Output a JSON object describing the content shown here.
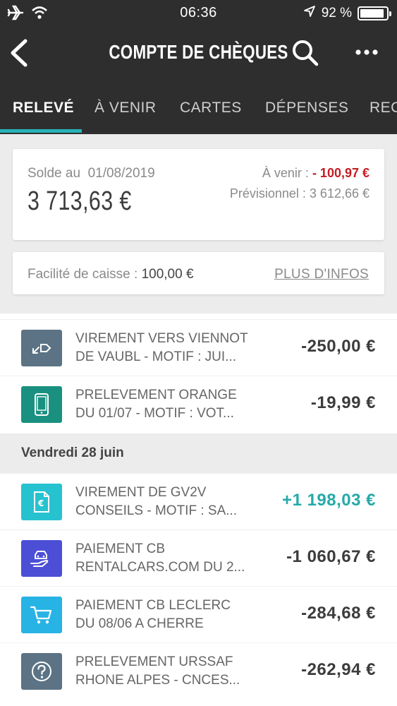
{
  "status_bar": {
    "time": "06:36",
    "battery_percent": "92 %",
    "battery_level": 0.92,
    "icons": [
      "airplane-icon",
      "wifi-icon",
      "location-arrow-icon",
      "battery-icon"
    ]
  },
  "header": {
    "title": "COMPTE DE CHÈQUES",
    "icons": [
      "back-chevron-icon",
      "search-icon",
      "more-dots-icon"
    ]
  },
  "tabs": [
    {
      "label": "RELEVÉ",
      "active": true
    },
    {
      "label": "À VENIR",
      "active": false
    },
    {
      "label": "CARTES",
      "active": false
    },
    {
      "label": "DÉPENSES",
      "active": false
    },
    {
      "label": "REC",
      "active": false
    }
  ],
  "balance": {
    "label": "Solde au",
    "date": "01/08/2019",
    "amount": "3 713,63 €",
    "upcoming_label": "À venir :",
    "upcoming_value": "- 100,97 €",
    "forecast_label": "Prévisionnel :",
    "forecast_value": "3 612,66 €"
  },
  "facility": {
    "label": "Facilité de caisse :",
    "value": "100,00 €",
    "link": "PLUS D'INFOS"
  },
  "transactions_top": [
    {
      "line1": "VIREMENT VERS VIENNOT",
      "line2": "DE VAUBL  - MOTIF : JUI...",
      "amount": "-250,00 €",
      "icon": "transfer-out-icon",
      "color": "#5b7384"
    },
    {
      "line1": "PRELEVEMENT ORANGE",
      "line2": "DU 01/07 - MOTIF : VOT...",
      "amount": "-19,99 €",
      "icon": "phone-icon",
      "color": "#1a9180"
    }
  ],
  "day_header": "Vendredi 28 juin",
  "transactions_day": [
    {
      "line1": "VIREMENT DE GV2V",
      "line2": "CONSEILS  - MOTIF : SA...",
      "amount": "+1 198,03 €",
      "icon": "euro-document-icon",
      "color": "#27c2cf",
      "positive": true
    },
    {
      "line1": "PAIEMENT CB",
      "line2": "RENTALCARS.COM DU 2...",
      "amount": "-1 060,67 €",
      "icon": "car-hand-icon",
      "color": "#4c4fd6"
    },
    {
      "line1": "PAIEMENT CB LECLERC",
      "line2": "DU 08/06 A CHERRE",
      "amount": "-284,68 €",
      "icon": "shopping-cart-icon",
      "color": "#27b3e4"
    },
    {
      "line1": "PRELEVEMENT URSSAF",
      "line2": "RHONE ALPES - CNCES...",
      "amount": "-262,94 €",
      "icon": "question-circle-icon",
      "color": "#5b7384"
    }
  ]
}
